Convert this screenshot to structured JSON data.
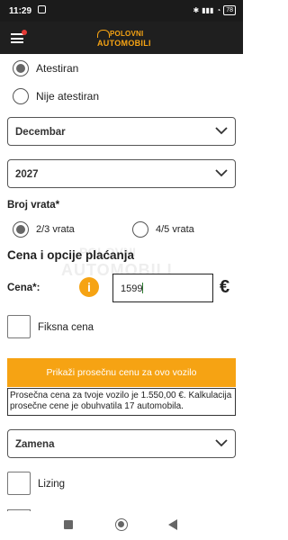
{
  "status_bar": {
    "time": "11:29",
    "battery": "78"
  },
  "logo": {
    "line1": "POLOVNI",
    "line2": "AUTOMOBILI"
  },
  "registration": {
    "options": [
      {
        "label": "Atestiran",
        "selected": true
      },
      {
        "label": "Nije atestiran",
        "selected": false
      }
    ]
  },
  "month_select": {
    "value": "Decembar"
  },
  "year_select": {
    "value": "2027"
  },
  "doors": {
    "title": "Broj vrata*",
    "options": [
      {
        "label": "2/3 vrata",
        "selected": true
      },
      {
        "label": "4/5 vrata",
        "selected": false
      }
    ]
  },
  "price_section": {
    "heading": "Cena i opcije plaćanja",
    "price_label": "Cena*:",
    "info_icon": "i",
    "price_value": "1599",
    "currency": "€",
    "fixed_price_label": "Fiksna cena",
    "avg_button": "Prikaži prosečnu cenu za ovo vozilo",
    "avg_text": "Prosečna cena za tvoje vozilo je 1.550,00 €. Kalkulacija prosečne cene je obuhvatila 17 automobila."
  },
  "exchange_select": {
    "value": "Zamena"
  },
  "leasing": {
    "label": "Lizing"
  },
  "watermark": {
    "line1": "POLOVNI",
    "line2": "AUTOMOBILI"
  },
  "colors": {
    "accent": "#f6a313",
    "topbar": "#1f1f1f"
  },
  "icons": [
    "menu-icon",
    "car-logo-icon",
    "chevron-down-icon",
    "info-icon",
    "euro-icon",
    "nav-recents-icon",
    "nav-home-icon",
    "nav-back-icon"
  ]
}
